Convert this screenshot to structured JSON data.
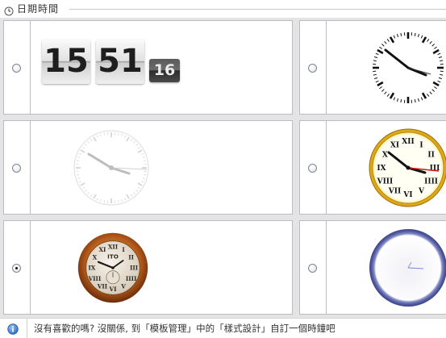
{
  "section": {
    "title": "日期時間",
    "icon": "clock-icon"
  },
  "clocks": [
    {
      "id": "flip-digital",
      "style": "flip digital clock",
      "hours": "15",
      "minutes": "51",
      "seconds": "16",
      "selected": false
    },
    {
      "id": "classic-black",
      "style": "classic black analog clock",
      "selected": false
    },
    {
      "id": "faded-gray",
      "style": "faded gray analog clock",
      "selected": false
    },
    {
      "id": "roman-gold",
      "style": "gold roman numeral clock",
      "selected": false
    },
    {
      "id": "wooden-roman",
      "style": "wooden roman numeral clock with sub-dial",
      "dial_text": "ITO",
      "selected": true
    },
    {
      "id": "blue-ring",
      "style": "blue ring minimal clock",
      "selected": false
    }
  ],
  "footer": {
    "icon": "info-icon",
    "hint": "沒有喜歡的嗎? 沒關係, 到「模板管理」中的「樣式設計」自訂一個時鐘吧"
  },
  "colors": {
    "grid_background": "#e4e4e4",
    "cell_border": "#b9bcc3",
    "gold_rim": "#d9a515",
    "wood_rim": "#b55c1c",
    "blue_ring": "#6f77b8",
    "second_hand_red": "#d21616"
  }
}
